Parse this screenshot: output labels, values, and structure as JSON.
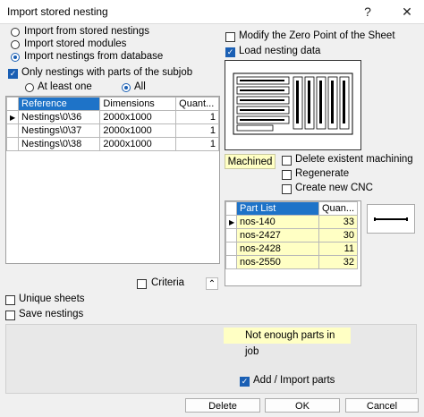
{
  "window": {
    "title": "Import stored nesting",
    "help_label": "?",
    "close_label": "✕"
  },
  "source": {
    "options": [
      "Import from stored nestings",
      "Import stored modules",
      "Import nestings from database"
    ],
    "selected": 2
  },
  "filter": {
    "only_subjob_label": "Only nestings with parts of the subjob",
    "only_subjob_checked": true,
    "at_least_one_label": "At least one",
    "all_label": "All",
    "all_selected": true
  },
  "nestings_table": {
    "headers": [
      "Reference",
      "Dimensions",
      "Quant..."
    ],
    "rows": [
      {
        "reference": "Nestings\\0\\36",
        "dimensions": "2000x1000",
        "quantity": "1"
      },
      {
        "reference": "Nestings\\0\\37",
        "dimensions": "2000x1000",
        "quantity": "1"
      },
      {
        "reference": "Nestings\\0\\38",
        "dimensions": "2000x1000",
        "quantity": "1"
      }
    ]
  },
  "right": {
    "modify_zero_label": "Modify the Zero Point of the Sheet",
    "modify_zero_checked": false,
    "load_data_label": "Load nesting data",
    "load_data_checked": true,
    "machined_label": "Machined",
    "delete_machining_label": "Delete existent machining",
    "regenerate_label": "Regenerate",
    "create_cnc_label": "Create new CNC"
  },
  "parts_table": {
    "headers": [
      "Part List",
      "Quan..."
    ],
    "rows": [
      {
        "part": "nos-140",
        "quantity": "33"
      },
      {
        "part": "nos-2427",
        "quantity": "30"
      },
      {
        "part": "nos-2428",
        "quantity": "11"
      },
      {
        "part": "nos-2550",
        "quantity": "32"
      }
    ]
  },
  "criteria_label": "Criteria",
  "collapse_glyph": "⌃",
  "unique_sheets_label": "Unique sheets",
  "save_nestings_label": "Save nestings",
  "legend": {
    "not_enough_label": "Not enough parts in job",
    "color": "#ffffc4"
  },
  "add_import_label": "Add / Import parts",
  "add_import_checked": true,
  "buttons": {
    "delete": "Delete",
    "ok": "OK",
    "cancel": "Cancel"
  },
  "colors": {
    "accent": "#1a5fb4",
    "header_selected": "#1e73c8",
    "highlight": "#ffffc4"
  }
}
